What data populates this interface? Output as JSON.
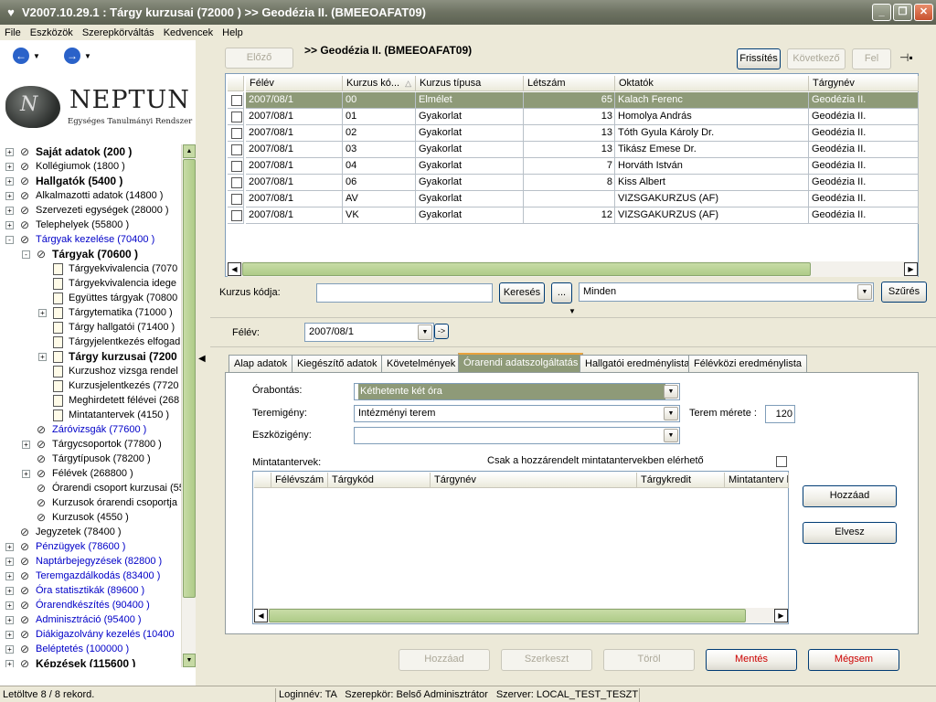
{
  "window": {
    "title": "V2007.10.29.1 : Tárgy kurzusai (72000  )  >> Geodézia II. (BMEEOAFAT09)"
  },
  "menu": [
    "File",
    "Eszközök",
    "Szerepkörváltás",
    "Kedvencek",
    "Help"
  ],
  "logo": {
    "name": "NEPTUN",
    "subtitle": "Egységes Tanulmányi Rendszer"
  },
  "tree": [
    {
      "label": "Saját adatok (200  )",
      "level": 0,
      "exp": "+",
      "bold": true
    },
    {
      "label": "Kollégiumok (1800  )",
      "level": 0,
      "exp": "+"
    },
    {
      "label": "Hallgatók (5400  )",
      "level": 0,
      "exp": "+",
      "bold": true
    },
    {
      "label": "Alkalmazotti adatok (14800  )",
      "level": 0,
      "exp": "+"
    },
    {
      "label": "Szervezeti egységek (28000  )",
      "level": 0,
      "exp": "+"
    },
    {
      "label": "Telephelyek (55800  )",
      "level": 0,
      "exp": "+"
    },
    {
      "label": "Tárgyak kezelése (70400  )",
      "level": 0,
      "exp": "-",
      "blue": true
    },
    {
      "label": "Tárgyak (70600  )",
      "level": 1,
      "exp": "-",
      "bold": true
    },
    {
      "label": "Tárgyekvivalencia (7070",
      "level": 2,
      "doc": true
    },
    {
      "label": "Tárgyekvivalencia idege",
      "level": 2,
      "doc": true
    },
    {
      "label": "Együttes tárgyak (70800",
      "level": 2,
      "doc": true
    },
    {
      "label": "Tárgytematika (71000  )",
      "level": 2,
      "exp": "+",
      "doc": true
    },
    {
      "label": "Tárgy hallgatói (71400  )",
      "level": 2,
      "doc": true
    },
    {
      "label": "Tárgyjelentkezés elfogad",
      "level": 2,
      "doc": true
    },
    {
      "label": "Tárgy kurzusai (7200",
      "level": 2,
      "exp": "+",
      "doc": true,
      "bold": true
    },
    {
      "label": "Kurzushoz vizsga rendel",
      "level": 2,
      "doc": true
    },
    {
      "label": "Kurzusjelentkezés (7720",
      "level": 2,
      "doc": true
    },
    {
      "label": "Meghirdetett félévei (268",
      "level": 2,
      "doc": true
    },
    {
      "label": "Mintatantervek (4150  )",
      "level": 2,
      "doc": true
    },
    {
      "label": "Záróvizsgák (77600  )",
      "level": 1,
      "blue": true
    },
    {
      "label": "Tárgycsoportok (77800  )",
      "level": 1,
      "exp": "+"
    },
    {
      "label": "Tárgytípusok (78200  )",
      "level": 1
    },
    {
      "label": "Félévek (268800  )",
      "level": 1,
      "exp": "+"
    },
    {
      "label": "Órarendi csoport kurzusai (55",
      "level": 1
    },
    {
      "label": "Kurzusok órarendi csoportja",
      "level": 1
    },
    {
      "label": "Kurzusok (4550  )",
      "level": 1
    },
    {
      "label": "Jegyzetek (78400  )",
      "level": 0
    },
    {
      "label": "Pénzügyek (78600  )",
      "level": 0,
      "exp": "+",
      "blue": true
    },
    {
      "label": "Naptárbejegyzések (82800  )",
      "level": 0,
      "exp": "+",
      "blue": true
    },
    {
      "label": "Teremgazdálkodás (83400  )",
      "level": 0,
      "exp": "+",
      "blue": true
    },
    {
      "label": "Óra statisztikák (89600  )",
      "level": 0,
      "exp": "+",
      "blue": true
    },
    {
      "label": "Órarendkészítés (90400  )",
      "level": 0,
      "exp": "+",
      "blue": true
    },
    {
      "label": "Adminisztráció (95400  )",
      "level": 0,
      "exp": "+",
      "blue": true
    },
    {
      "label": "Diákigazolvány kezelés (10400",
      "level": 0,
      "exp": "+",
      "blue": true
    },
    {
      "label": "Beléptetés (100000  )",
      "level": 0,
      "exp": "+",
      "blue": true
    },
    {
      "label": "Képzések (115600  )",
      "level": 0,
      "exp": "+",
      "bold": true
    }
  ],
  "top": {
    "prev": "Előző",
    "title": ">> Geodézia II. (BMEEOAFAT09)",
    "refresh": "Frissítés",
    "next": "Következő",
    "up": "Fel"
  },
  "grid": {
    "headers": [
      "Félév",
      "Kurzus kó...",
      "Kurzus típusa",
      "Létszám",
      "Oktatók",
      "Tárgynév"
    ],
    "rows": [
      [
        "2007/08/1",
        "00",
        "Elmélet",
        "65",
        "Kalach Ferenc",
        "Geodézia II."
      ],
      [
        "2007/08/1",
        "01",
        "Gyakorlat",
        "13",
        "Homolya András",
        "Geodézia II."
      ],
      [
        "2007/08/1",
        "02",
        "Gyakorlat",
        "13",
        "Tóth Gyula Károly Dr.",
        "Geodézia II."
      ],
      [
        "2007/08/1",
        "03",
        "Gyakorlat",
        "13",
        "Tikász Emese Dr.",
        "Geodézia II."
      ],
      [
        "2007/08/1",
        "04",
        "Gyakorlat",
        "7",
        "Horváth István",
        "Geodézia II."
      ],
      [
        "2007/08/1",
        "06",
        "Gyakorlat",
        "8",
        "Kiss Albert",
        "Geodézia II."
      ],
      [
        "2007/08/1",
        "AV",
        "Gyakorlat",
        "",
        "VIZSGAKURZUS (AF)",
        "Geodézia II."
      ],
      [
        "2007/08/1",
        "VK",
        "Gyakorlat",
        "12",
        "VIZSGAKURZUS (AF)",
        "Geodézia II."
      ]
    ]
  },
  "search": {
    "label": "Kurzus kódja:",
    "value": "",
    "search_btn": "Keresés",
    "dots_btn": "...",
    "filter_value": "Minden",
    "filter_btn": "Szűrés"
  },
  "semester": {
    "label": "Félév:",
    "value": "2007/08/1",
    "go": "->"
  },
  "tabs": [
    "Alap adatok",
    "Kiegészítő adatok",
    "Követelmények",
    "Órarendi adatszolgáltatás",
    "Hallgatói eredménylista",
    "Félévközi eredménylista"
  ],
  "form": {
    "orabontas_label": "Órabontás:",
    "orabontas_value": "Kéthetente két óra",
    "teremigeny_label": "Teremigény:",
    "teremigeny_value": "Intézményi terem",
    "terem_merete_label": "Terem mérete :",
    "terem_merete_value": "120",
    "eszkozigeny_label": "Eszközigény:",
    "eszkozigeny_value": "",
    "mintatantervek_label": "Mintatantervek:",
    "csak_label": "Csak a hozzárendelt mintatantervekben elérhető",
    "sub_headers": [
      "Félévszám",
      "Tárgykód",
      "Tárgynév",
      "Tárgykredit",
      "Mintatanterv k"
    ],
    "add_btn": "Hozzáad",
    "remove_btn": "Elvesz"
  },
  "bottom": {
    "add": "Hozzáad",
    "edit": "Szerkeszt",
    "delete": "Töröl",
    "save": "Mentés",
    "cancel": "Mégsem"
  },
  "status": {
    "records": "Letöltve 8 / 8 rekord.",
    "login": "Loginnév: TA",
    "role": "Szerepkör: Belső Adminisztrátor",
    "server": "Szerver: LOCAL_TEST_TESZT"
  },
  "colors": {
    "selection": "#8e9a78",
    "titlebar": "#6d7262",
    "link_blue": "#0000c8",
    "danger": "#cc0000"
  }
}
